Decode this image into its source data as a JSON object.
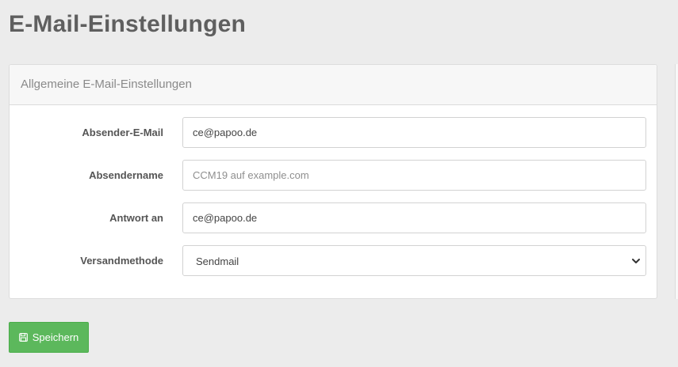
{
  "page": {
    "title": "E-Mail-Einstellungen"
  },
  "panel": {
    "heading": "Allgemeine E-Mail-Einstellungen",
    "fields": {
      "sender_email": {
        "label": "Absender-E-Mail",
        "value": "ce@papoo.de",
        "placeholder": ""
      },
      "sender_name": {
        "label": "Absendername",
        "value": "",
        "placeholder": "CCM19 auf example.com"
      },
      "reply_to": {
        "label": "Antwort an",
        "value": "ce@papoo.de",
        "placeholder": ""
      },
      "send_method": {
        "label": "Versandmethode",
        "selected": "Sendmail"
      }
    }
  },
  "actions": {
    "save_label": "Speichern",
    "save_icon": "floppy-disk-icon"
  },
  "colors": {
    "background": "#ececec",
    "title": "#5f5f5f",
    "save_button": "#5cb85c"
  }
}
